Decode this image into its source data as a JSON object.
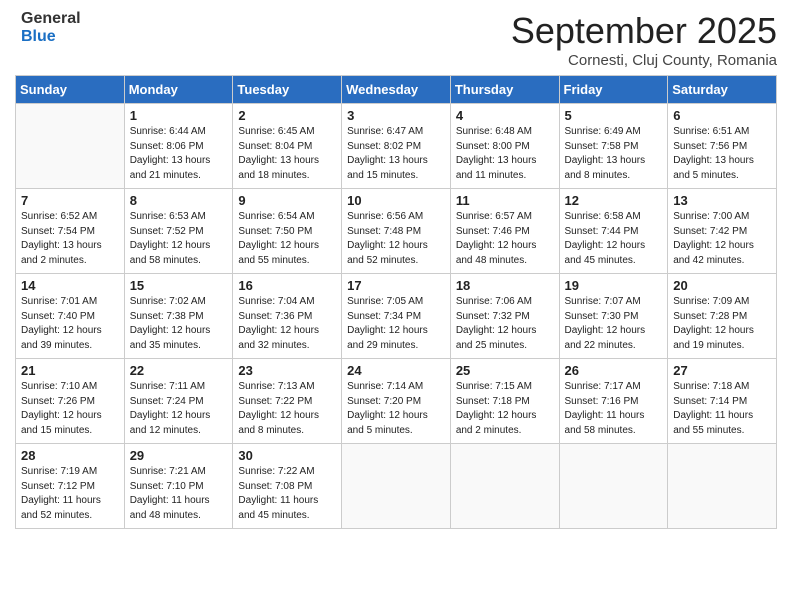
{
  "header": {
    "logo": {
      "general": "General",
      "blue": "Blue"
    },
    "title": "September 2025",
    "subtitle": "Cornesti, Cluj County, Romania"
  },
  "days_of_week": [
    "Sunday",
    "Monday",
    "Tuesday",
    "Wednesday",
    "Thursday",
    "Friday",
    "Saturday"
  ],
  "weeks": [
    [
      {
        "day": "",
        "info": ""
      },
      {
        "day": "1",
        "info": "Sunrise: 6:44 AM\nSunset: 8:06 PM\nDaylight: 13 hours and 21 minutes."
      },
      {
        "day": "2",
        "info": "Sunrise: 6:45 AM\nSunset: 8:04 PM\nDaylight: 13 hours and 18 minutes."
      },
      {
        "day": "3",
        "info": "Sunrise: 6:47 AM\nSunset: 8:02 PM\nDaylight: 13 hours and 15 minutes."
      },
      {
        "day": "4",
        "info": "Sunrise: 6:48 AM\nSunset: 8:00 PM\nDaylight: 13 hours and 11 minutes."
      },
      {
        "day": "5",
        "info": "Sunrise: 6:49 AM\nSunset: 7:58 PM\nDaylight: 13 hours and 8 minutes."
      },
      {
        "day": "6",
        "info": "Sunrise: 6:51 AM\nSunset: 7:56 PM\nDaylight: 13 hours and 5 minutes."
      }
    ],
    [
      {
        "day": "7",
        "info": "Sunrise: 6:52 AM\nSunset: 7:54 PM\nDaylight: 13 hours and 2 minutes."
      },
      {
        "day": "8",
        "info": "Sunrise: 6:53 AM\nSunset: 7:52 PM\nDaylight: 12 hours and 58 minutes."
      },
      {
        "day": "9",
        "info": "Sunrise: 6:54 AM\nSunset: 7:50 PM\nDaylight: 12 hours and 55 minutes."
      },
      {
        "day": "10",
        "info": "Sunrise: 6:56 AM\nSunset: 7:48 PM\nDaylight: 12 hours and 52 minutes."
      },
      {
        "day": "11",
        "info": "Sunrise: 6:57 AM\nSunset: 7:46 PM\nDaylight: 12 hours and 48 minutes."
      },
      {
        "day": "12",
        "info": "Sunrise: 6:58 AM\nSunset: 7:44 PM\nDaylight: 12 hours and 45 minutes."
      },
      {
        "day": "13",
        "info": "Sunrise: 7:00 AM\nSunset: 7:42 PM\nDaylight: 12 hours and 42 minutes."
      }
    ],
    [
      {
        "day": "14",
        "info": "Sunrise: 7:01 AM\nSunset: 7:40 PM\nDaylight: 12 hours and 39 minutes."
      },
      {
        "day": "15",
        "info": "Sunrise: 7:02 AM\nSunset: 7:38 PM\nDaylight: 12 hours and 35 minutes."
      },
      {
        "day": "16",
        "info": "Sunrise: 7:04 AM\nSunset: 7:36 PM\nDaylight: 12 hours and 32 minutes."
      },
      {
        "day": "17",
        "info": "Sunrise: 7:05 AM\nSunset: 7:34 PM\nDaylight: 12 hours and 29 minutes."
      },
      {
        "day": "18",
        "info": "Sunrise: 7:06 AM\nSunset: 7:32 PM\nDaylight: 12 hours and 25 minutes."
      },
      {
        "day": "19",
        "info": "Sunrise: 7:07 AM\nSunset: 7:30 PM\nDaylight: 12 hours and 22 minutes."
      },
      {
        "day": "20",
        "info": "Sunrise: 7:09 AM\nSunset: 7:28 PM\nDaylight: 12 hours and 19 minutes."
      }
    ],
    [
      {
        "day": "21",
        "info": "Sunrise: 7:10 AM\nSunset: 7:26 PM\nDaylight: 12 hours and 15 minutes."
      },
      {
        "day": "22",
        "info": "Sunrise: 7:11 AM\nSunset: 7:24 PM\nDaylight: 12 hours and 12 minutes."
      },
      {
        "day": "23",
        "info": "Sunrise: 7:13 AM\nSunset: 7:22 PM\nDaylight: 12 hours and 8 minutes."
      },
      {
        "day": "24",
        "info": "Sunrise: 7:14 AM\nSunset: 7:20 PM\nDaylight: 12 hours and 5 minutes."
      },
      {
        "day": "25",
        "info": "Sunrise: 7:15 AM\nSunset: 7:18 PM\nDaylight: 12 hours and 2 minutes."
      },
      {
        "day": "26",
        "info": "Sunrise: 7:17 AM\nSunset: 7:16 PM\nDaylight: 11 hours and 58 minutes."
      },
      {
        "day": "27",
        "info": "Sunrise: 7:18 AM\nSunset: 7:14 PM\nDaylight: 11 hours and 55 minutes."
      }
    ],
    [
      {
        "day": "28",
        "info": "Sunrise: 7:19 AM\nSunset: 7:12 PM\nDaylight: 11 hours and 52 minutes."
      },
      {
        "day": "29",
        "info": "Sunrise: 7:21 AM\nSunset: 7:10 PM\nDaylight: 11 hours and 48 minutes."
      },
      {
        "day": "30",
        "info": "Sunrise: 7:22 AM\nSunset: 7:08 PM\nDaylight: 11 hours and 45 minutes."
      },
      {
        "day": "",
        "info": ""
      },
      {
        "day": "",
        "info": ""
      },
      {
        "day": "",
        "info": ""
      },
      {
        "day": "",
        "info": ""
      }
    ]
  ]
}
